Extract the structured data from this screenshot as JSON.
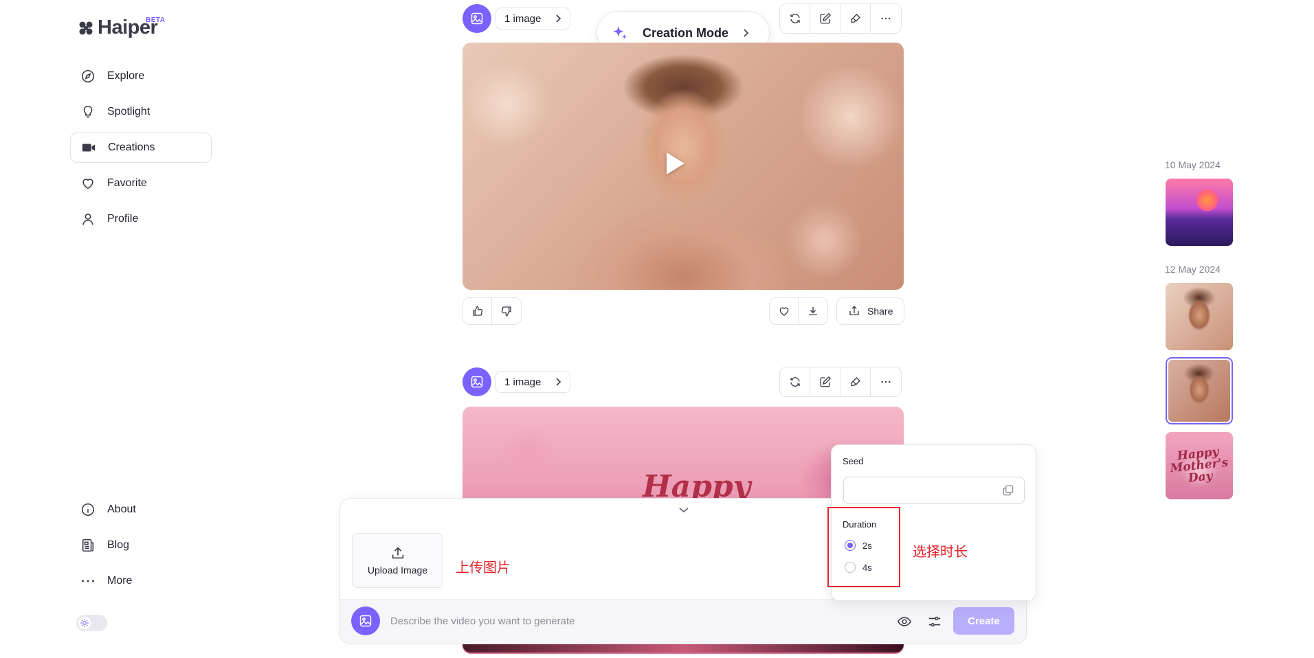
{
  "brand": {
    "name": "Haiper",
    "badge": "BETA"
  },
  "sidebar": {
    "items": [
      {
        "label": "Explore",
        "icon": "compass-icon"
      },
      {
        "label": "Spotlight",
        "icon": "lightbulb-icon"
      },
      {
        "label": "Creations",
        "icon": "video-camera-icon",
        "active": true
      },
      {
        "label": "Favorite",
        "icon": "heart-icon"
      },
      {
        "label": "Profile",
        "icon": "user-icon"
      }
    ],
    "footer": [
      {
        "label": "About",
        "icon": "info-icon"
      },
      {
        "label": "Blog",
        "icon": "blog-icon"
      },
      {
        "label": "More",
        "icon": "more-dots-icon"
      }
    ]
  },
  "header": {
    "creation_mode": "Creation Mode"
  },
  "cards": [
    {
      "source_label": "1 image",
      "actions": {
        "share": "Share"
      }
    },
    {
      "source_label": "1 image",
      "overlay_text": "Happy"
    }
  ],
  "composer": {
    "upload_label": "Upload Image",
    "prompt_placeholder": "Describe the video you want to generate",
    "create_label": "Create"
  },
  "settings": {
    "seed_label": "Seed",
    "seed_value": "",
    "duration_label": "Duration",
    "duration_options": [
      "2s",
      "4s"
    ],
    "duration_selected": "2s"
  },
  "annotations": {
    "upload": "上传图片",
    "duration": "选择时长"
  },
  "gallery": {
    "groups": [
      {
        "date": "10 May 2024"
      },
      {
        "date": "12 May 2024"
      }
    ],
    "thumb4_text": "Happy Mother's Day"
  },
  "colors": {
    "accent": "#7b61ff",
    "annotation_red": "#e6242b",
    "create_disabled": "#b9aefc"
  }
}
